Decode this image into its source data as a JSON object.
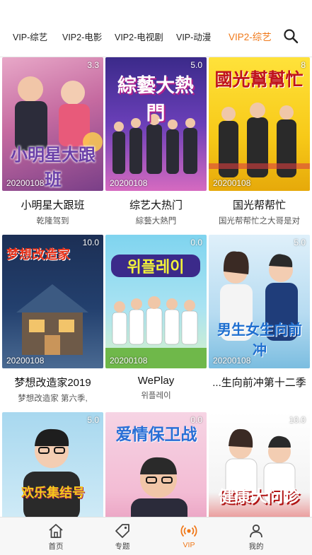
{
  "tabs": [
    {
      "label": "VIP-综艺"
    },
    {
      "label": "VIP2-电影"
    },
    {
      "label": "VIP2-电视剧"
    },
    {
      "label": "VIP-动漫"
    },
    {
      "label": "VIP2-综艺"
    }
  ],
  "active_tab": "VIP2-综艺",
  "accent_color": "#f07818",
  "items": [
    {
      "title": "小明星大跟班",
      "subtitle": "乾隆驾到",
      "score": "3.3",
      "date": "20200108",
      "poster_text": "小明星大跟班"
    },
    {
      "title": "综艺大热门",
      "subtitle": "綜藝大熱門",
      "score": "5.0",
      "date": "20200108",
      "poster_text": "綜藝大熱門"
    },
    {
      "title": "国光帮帮忙",
      "subtitle": "国光帮帮忙之大哥是对",
      "score": "8",
      "date": "20200108",
      "poster_text": "國光幫幫忙"
    },
    {
      "title": "梦想改造家2019",
      "subtitle": "梦想改造家 第六季,",
      "score": "10.0",
      "date": "20200108",
      "poster_text": "梦想改造家"
    },
    {
      "title": "WePlay",
      "subtitle": "위플레이",
      "score": "0.0",
      "date": "20200108",
      "poster_text": "위플레이"
    },
    {
      "title": "...生向前冲第十二季",
      "subtitle": "",
      "score": "5.0",
      "date": "20200108",
      "poster_text": "男生女生向前冲"
    },
    {
      "title": "",
      "subtitle": "",
      "score": "5.0",
      "date": "",
      "poster_text": "欢乐集结号"
    },
    {
      "title": "",
      "subtitle": "",
      "score": "0.0",
      "date": "",
      "poster_text": "爱情保卫战"
    },
    {
      "title": "",
      "subtitle": "",
      "score": "10.0",
      "date": "",
      "poster_text": "健康大问诊"
    }
  ],
  "bottom_nav": [
    {
      "label": "首页",
      "icon": "home-icon"
    },
    {
      "label": "专题",
      "icon": "tag-icon"
    },
    {
      "label": "VIP",
      "icon": "broadcast-icon"
    },
    {
      "label": "我的",
      "icon": "user-icon"
    }
  ]
}
